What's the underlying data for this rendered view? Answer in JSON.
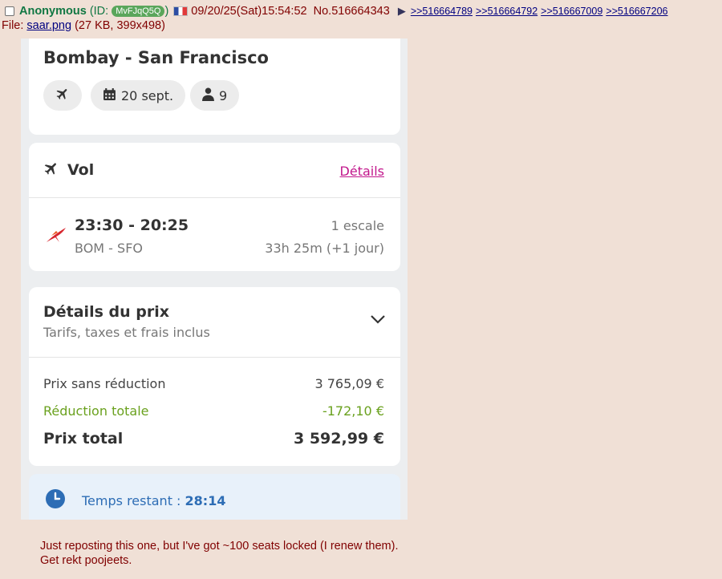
{
  "post": {
    "name": "Anonymous",
    "id_prefix": "(ID: ",
    "poster_id": "MvFJqQ5Q",
    "id_suffix": ")",
    "datetime": "09/20/25(Sat)15:54:52",
    "number": "No.516664343",
    "replies": [
      ">>516664789",
      ">>516664792",
      ">>516667009",
      ">>516667206"
    ],
    "file_prefix": "File: ",
    "file_name": "saar.png",
    "file_info": " (27 KB, 399x498)",
    "comment_lines": [
      "Just reposting this one, but I've got ~100 seats locked (I renew them).",
      "Get rekt poojeets."
    ]
  },
  "booking": {
    "route": "Bombay - San Francisco",
    "date": "20 sept.",
    "passengers": "9",
    "flight_section": "Vol",
    "details_link": "Détails",
    "times": "23:30 - 20:25",
    "airports": "BOM - SFO",
    "stops": "1 escale",
    "duration": "33h 25m (+1 jour)",
    "price_title": "Détails du prix",
    "price_subtitle": "Tarifs, taxes et frais inclus",
    "base_label": "Prix sans réduction",
    "base_value": "3 765,09 €",
    "discount_label": "Réduction totale",
    "discount_value": "-172,10 €",
    "total_label": "Prix total",
    "total_value": "3 592,99 €",
    "timer_label": "Temps restant : ",
    "timer_value": "28:14"
  },
  "colors": {
    "background": "#f0e0d6",
    "name_green": "#117743",
    "link_blue": "#000080",
    "details_pink": "#c2178c",
    "discount_green": "#6aa11e",
    "timer_blue": "#2d6db5"
  },
  "icons": [
    "checkbox",
    "flag-france-icon",
    "plane-icon",
    "calendar-icon",
    "person-icon",
    "airline-logo-icon",
    "chevron-down-icon",
    "clock-icon"
  ]
}
